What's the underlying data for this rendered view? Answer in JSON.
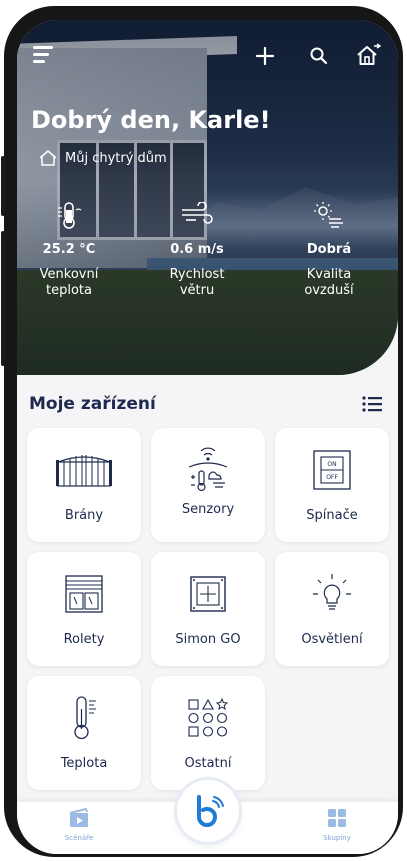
{
  "header": {
    "greeting": "Dobrý den, Karle!",
    "home_name": "Můj chytrý dům"
  },
  "stats": [
    {
      "value": "25.2 °C",
      "label": "Venkovní\nteplota",
      "icon": "thermometer-icon"
    },
    {
      "value": "0.6 m/s",
      "label": "Rychlost\nvětru",
      "icon": "wind-icon"
    },
    {
      "value": "Dobrá",
      "label": "Kvalita\novzduší",
      "icon": "air-quality-icon"
    }
  ],
  "devices": {
    "title": "Moje zařízení",
    "tiles": [
      {
        "label": "Brány",
        "icon": "gate-icon"
      },
      {
        "label": "Senzory",
        "icon": "sensors-icon"
      },
      {
        "label": "Spínače",
        "icon": "switch-icon"
      },
      {
        "label": "Rolety",
        "icon": "blinds-icon"
      },
      {
        "label": "Simon GO",
        "icon": "simon-go-icon"
      },
      {
        "label": "Osvětlení",
        "icon": "light-bulb-icon"
      },
      {
        "label": "Teplota",
        "icon": "thermometer-icon"
      },
      {
        "label": "Ostatní",
        "icon": "shapes-icon"
      }
    ],
    "switch_on": "ON",
    "switch_off": "OFF"
  },
  "bottom_nav": {
    "left_label": "Scénáře",
    "right_label": "Skupiny"
  },
  "colors": {
    "accent": "#1d2a4d",
    "nav_blue": "#7fa3d4",
    "center_blue": "#1e7bd6"
  }
}
